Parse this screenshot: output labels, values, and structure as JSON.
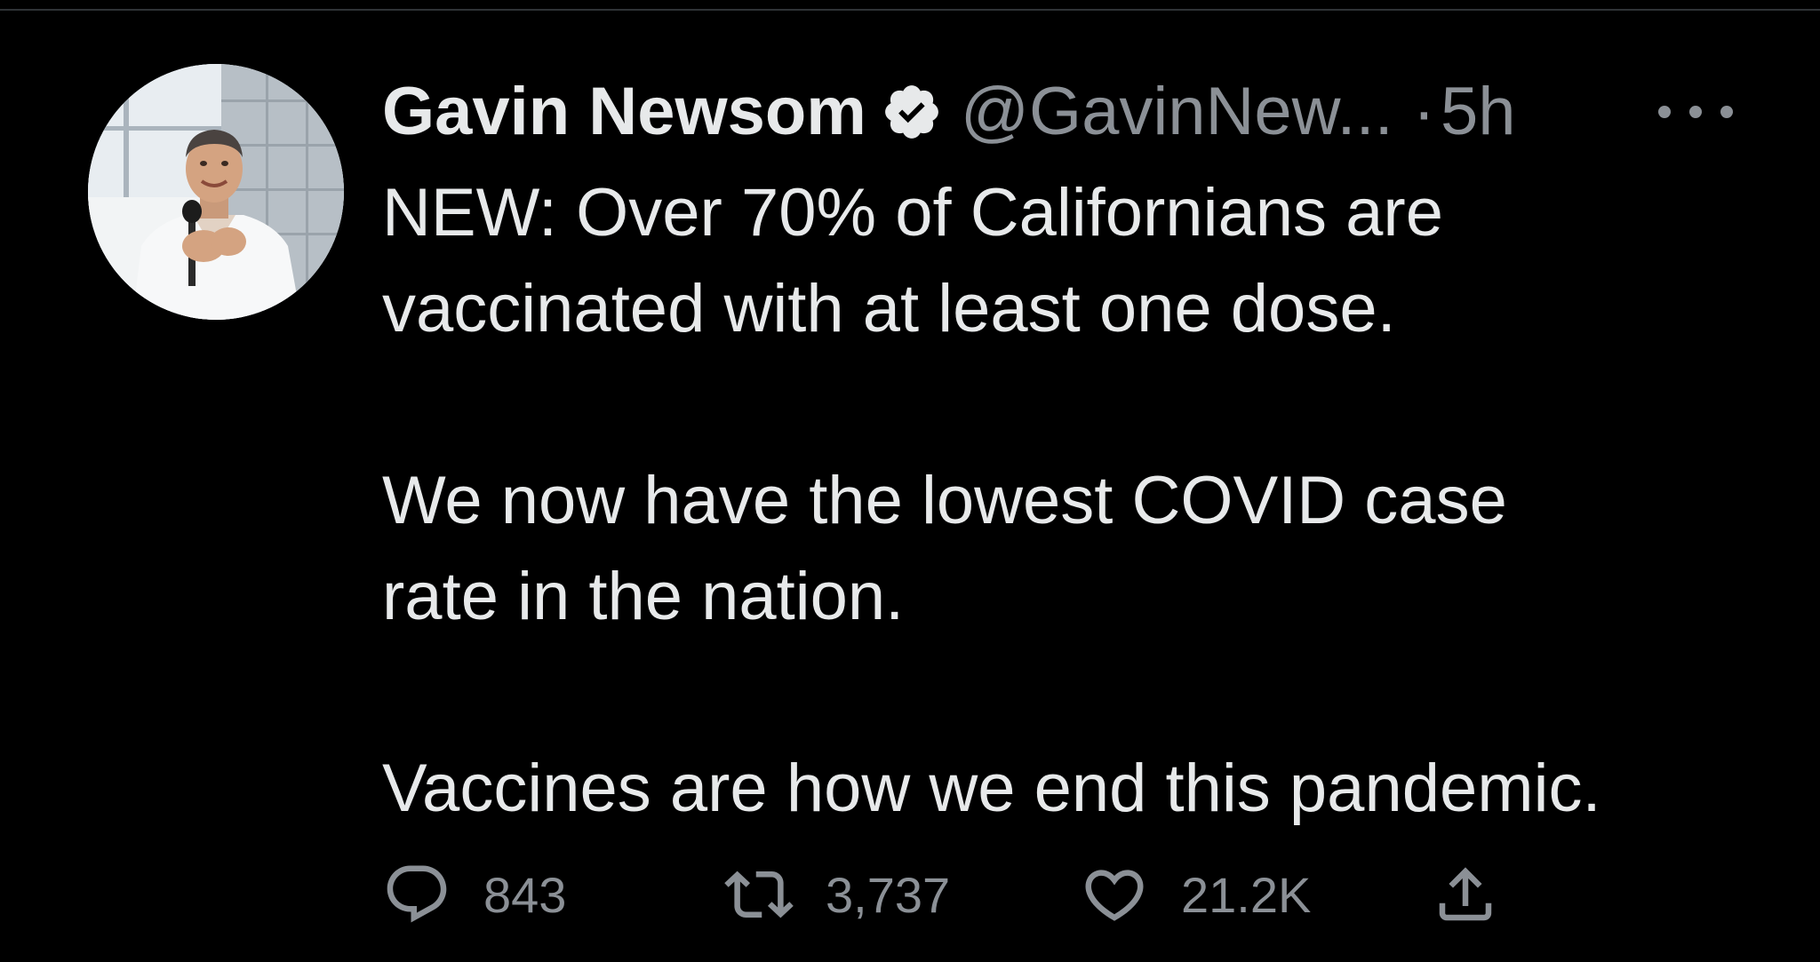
{
  "tweet": {
    "author": {
      "display_name": "Gavin Newsom",
      "verified": true,
      "verified_icon": "verified-badge-icon",
      "handle": "@GavinNew...",
      "avatar": "profile photo of man in white shirt speaking at microphone"
    },
    "separator": "·",
    "timestamp": "5h",
    "more_icon": "more-options-icon",
    "body": {
      "line1": "NEW: Over 70% of Californians are",
      "line2": "vaccinated with at least one dose.",
      "line3": "We now have the lowest COVID case",
      "line4": "rate in the nation.",
      "line5": "Vaccines are how we end this pandemic."
    },
    "actions": {
      "reply": {
        "icon": "reply-icon",
        "count": "843"
      },
      "retweet": {
        "icon": "retweet-icon",
        "count": "3,737"
      },
      "like": {
        "icon": "heart-icon",
        "count": "21.2K"
      },
      "share": {
        "icon": "share-icon"
      }
    }
  },
  "colors": {
    "background": "#000000",
    "primary_text": "#e7e9ea",
    "secondary_text": "#8b9096",
    "divider": "#2f3336"
  }
}
